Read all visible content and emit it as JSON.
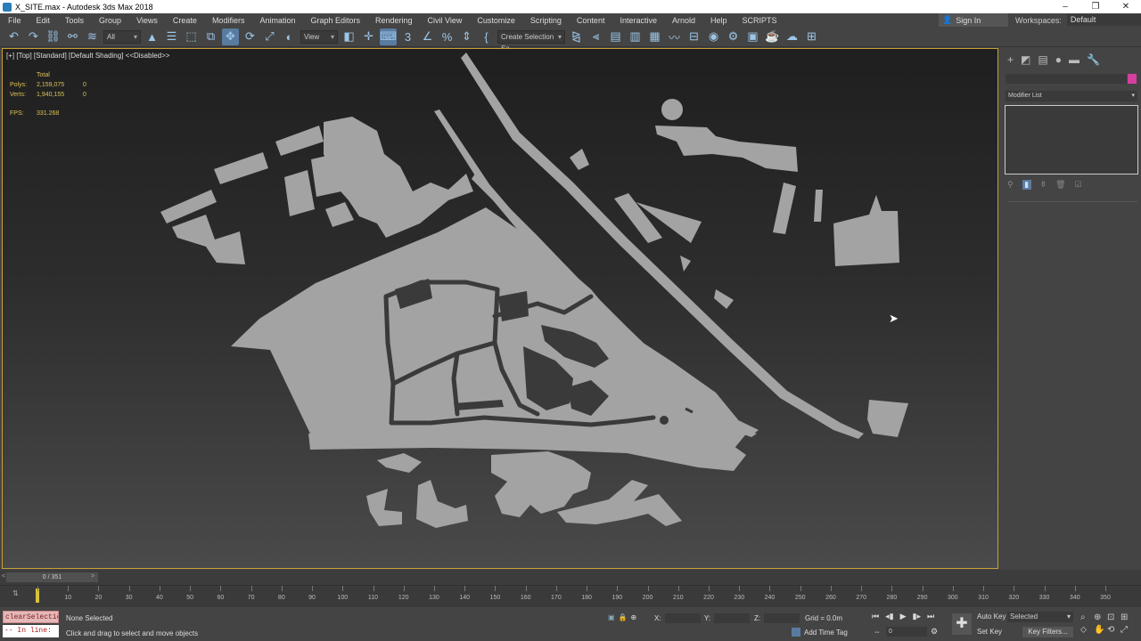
{
  "window": {
    "title": "X_SITE.max - Autodesk 3ds Max 2018",
    "buttons": [
      "–",
      "❐",
      "✕"
    ]
  },
  "menu": [
    "File",
    "Edit",
    "Tools",
    "Group",
    "Views",
    "Create",
    "Modifiers",
    "Animation",
    "Graph Editors",
    "Rendering",
    "Civil View",
    "Customize",
    "Scripting",
    "Content",
    "Interactive",
    "Arnold",
    "Help",
    "SCRIPTS"
  ],
  "signin": {
    "label": "Sign In"
  },
  "workspaces": {
    "label": "Workspaces:",
    "value": "Default"
  },
  "toolbar": {
    "filter_value": "All",
    "refcoord_value": "View",
    "selection_set_placeholder": "Create Selection Se"
  },
  "viewport": {
    "label": "[+] [Top] [Standard] [Default Shading]  <<Disabled>>",
    "stats": {
      "header": "Total",
      "polys_label": "Polys:",
      "polys_value": "2,159,075",
      "polys_sel": "0",
      "verts_label": "Verts:",
      "verts_value": "1,940,155",
      "verts_sel": "0",
      "fps_label": "FPS:",
      "fps_value": "331.268"
    }
  },
  "command_panel": {
    "modifier_list": "Modifier List",
    "object_color": "#d63fa0"
  },
  "timeslider": {
    "frame_display": "0 / 351",
    "prev": "<",
    "next": ">"
  },
  "timeline": {
    "ticks": [
      0,
      10,
      20,
      30,
      40,
      50,
      60,
      70,
      80,
      90,
      100,
      110,
      120,
      130,
      140,
      150,
      160,
      170,
      180,
      190,
      200,
      210,
      220,
      230,
      240,
      250,
      260,
      270,
      280,
      290,
      300,
      310,
      320,
      330,
      340,
      350
    ]
  },
  "status": {
    "maxscript_cmd": "clearSelectio",
    "maxscript_line": "-- In line:",
    "selection": "None Selected",
    "hint": "Click and drag to select and move objects",
    "x_label": "X:",
    "y_label": "Y:",
    "z_label": "Z:",
    "grid": "Grid = 0.0m",
    "add_time_tag": "Add Time Tag",
    "frame_value": "0",
    "auto_key": "Auto Key",
    "set_key": "Set Key",
    "selected_drop": "Selected",
    "key_filters": "Key Filters..."
  }
}
